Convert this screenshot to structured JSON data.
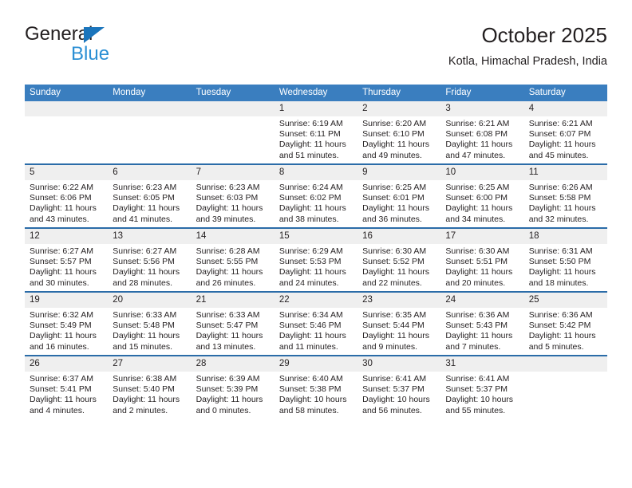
{
  "brand": {
    "name_top": "General",
    "name_bottom": "Blue",
    "accent_color": "#1b75bc",
    "accent_color_light": "#2b8fd4"
  },
  "header": {
    "title": "October 2025",
    "subtitle": "Kotla, Himachal Pradesh, India"
  },
  "theme": {
    "header_row_bg": "#3a7ebf",
    "week_separator": "#2b6ca8",
    "daynum_bg": "#efefef",
    "text": "#231f20"
  },
  "weekdays": [
    "Sunday",
    "Monday",
    "Tuesday",
    "Wednesday",
    "Thursday",
    "Friday",
    "Saturday"
  ],
  "labels": {
    "sunrise": "Sunrise:",
    "sunset": "Sunset:",
    "daylight": "Daylight:"
  },
  "weeks": [
    [
      {
        "day": "",
        "blank": true,
        "sunrise": "",
        "sunset": "",
        "daylight_line1": "",
        "daylight_line2": ""
      },
      {
        "day": "",
        "blank": true,
        "sunrise": "",
        "sunset": "",
        "daylight_line1": "",
        "daylight_line2": ""
      },
      {
        "day": "",
        "blank": true,
        "sunrise": "",
        "sunset": "",
        "daylight_line1": "",
        "daylight_line2": ""
      },
      {
        "day": "1",
        "blank": false,
        "sunrise": "Sunrise: 6:19 AM",
        "sunset": "Sunset: 6:11 PM",
        "daylight_line1": "Daylight: 11 hours",
        "daylight_line2": "and 51 minutes."
      },
      {
        "day": "2",
        "blank": false,
        "sunrise": "Sunrise: 6:20 AM",
        "sunset": "Sunset: 6:10 PM",
        "daylight_line1": "Daylight: 11 hours",
        "daylight_line2": "and 49 minutes."
      },
      {
        "day": "3",
        "blank": false,
        "sunrise": "Sunrise: 6:21 AM",
        "sunset": "Sunset: 6:08 PM",
        "daylight_line1": "Daylight: 11 hours",
        "daylight_line2": "and 47 minutes."
      },
      {
        "day": "4",
        "blank": false,
        "sunrise": "Sunrise: 6:21 AM",
        "sunset": "Sunset: 6:07 PM",
        "daylight_line1": "Daylight: 11 hours",
        "daylight_line2": "and 45 minutes."
      }
    ],
    [
      {
        "day": "5",
        "blank": false,
        "sunrise": "Sunrise: 6:22 AM",
        "sunset": "Sunset: 6:06 PM",
        "daylight_line1": "Daylight: 11 hours",
        "daylight_line2": "and 43 minutes."
      },
      {
        "day": "6",
        "blank": false,
        "sunrise": "Sunrise: 6:23 AM",
        "sunset": "Sunset: 6:05 PM",
        "daylight_line1": "Daylight: 11 hours",
        "daylight_line2": "and 41 minutes."
      },
      {
        "day": "7",
        "blank": false,
        "sunrise": "Sunrise: 6:23 AM",
        "sunset": "Sunset: 6:03 PM",
        "daylight_line1": "Daylight: 11 hours",
        "daylight_line2": "and 39 minutes."
      },
      {
        "day": "8",
        "blank": false,
        "sunrise": "Sunrise: 6:24 AM",
        "sunset": "Sunset: 6:02 PM",
        "daylight_line1": "Daylight: 11 hours",
        "daylight_line2": "and 38 minutes."
      },
      {
        "day": "9",
        "blank": false,
        "sunrise": "Sunrise: 6:25 AM",
        "sunset": "Sunset: 6:01 PM",
        "daylight_line1": "Daylight: 11 hours",
        "daylight_line2": "and 36 minutes."
      },
      {
        "day": "10",
        "blank": false,
        "sunrise": "Sunrise: 6:25 AM",
        "sunset": "Sunset: 6:00 PM",
        "daylight_line1": "Daylight: 11 hours",
        "daylight_line2": "and 34 minutes."
      },
      {
        "day": "11",
        "blank": false,
        "sunrise": "Sunrise: 6:26 AM",
        "sunset": "Sunset: 5:58 PM",
        "daylight_line1": "Daylight: 11 hours",
        "daylight_line2": "and 32 minutes."
      }
    ],
    [
      {
        "day": "12",
        "blank": false,
        "sunrise": "Sunrise: 6:27 AM",
        "sunset": "Sunset: 5:57 PM",
        "daylight_line1": "Daylight: 11 hours",
        "daylight_line2": "and 30 minutes."
      },
      {
        "day": "13",
        "blank": false,
        "sunrise": "Sunrise: 6:27 AM",
        "sunset": "Sunset: 5:56 PM",
        "daylight_line1": "Daylight: 11 hours",
        "daylight_line2": "and 28 minutes."
      },
      {
        "day": "14",
        "blank": false,
        "sunrise": "Sunrise: 6:28 AM",
        "sunset": "Sunset: 5:55 PM",
        "daylight_line1": "Daylight: 11 hours",
        "daylight_line2": "and 26 minutes."
      },
      {
        "day": "15",
        "blank": false,
        "sunrise": "Sunrise: 6:29 AM",
        "sunset": "Sunset: 5:53 PM",
        "daylight_line1": "Daylight: 11 hours",
        "daylight_line2": "and 24 minutes."
      },
      {
        "day": "16",
        "blank": false,
        "sunrise": "Sunrise: 6:30 AM",
        "sunset": "Sunset: 5:52 PM",
        "daylight_line1": "Daylight: 11 hours",
        "daylight_line2": "and 22 minutes."
      },
      {
        "day": "17",
        "blank": false,
        "sunrise": "Sunrise: 6:30 AM",
        "sunset": "Sunset: 5:51 PM",
        "daylight_line1": "Daylight: 11 hours",
        "daylight_line2": "and 20 minutes."
      },
      {
        "day": "18",
        "blank": false,
        "sunrise": "Sunrise: 6:31 AM",
        "sunset": "Sunset: 5:50 PM",
        "daylight_line1": "Daylight: 11 hours",
        "daylight_line2": "and 18 minutes."
      }
    ],
    [
      {
        "day": "19",
        "blank": false,
        "sunrise": "Sunrise: 6:32 AM",
        "sunset": "Sunset: 5:49 PM",
        "daylight_line1": "Daylight: 11 hours",
        "daylight_line2": "and 16 minutes."
      },
      {
        "day": "20",
        "blank": false,
        "sunrise": "Sunrise: 6:33 AM",
        "sunset": "Sunset: 5:48 PM",
        "daylight_line1": "Daylight: 11 hours",
        "daylight_line2": "and 15 minutes."
      },
      {
        "day": "21",
        "blank": false,
        "sunrise": "Sunrise: 6:33 AM",
        "sunset": "Sunset: 5:47 PM",
        "daylight_line1": "Daylight: 11 hours",
        "daylight_line2": "and 13 minutes."
      },
      {
        "day": "22",
        "blank": false,
        "sunrise": "Sunrise: 6:34 AM",
        "sunset": "Sunset: 5:46 PM",
        "daylight_line1": "Daylight: 11 hours",
        "daylight_line2": "and 11 minutes."
      },
      {
        "day": "23",
        "blank": false,
        "sunrise": "Sunrise: 6:35 AM",
        "sunset": "Sunset: 5:44 PM",
        "daylight_line1": "Daylight: 11 hours",
        "daylight_line2": "and 9 minutes."
      },
      {
        "day": "24",
        "blank": false,
        "sunrise": "Sunrise: 6:36 AM",
        "sunset": "Sunset: 5:43 PM",
        "daylight_line1": "Daylight: 11 hours",
        "daylight_line2": "and 7 minutes."
      },
      {
        "day": "25",
        "blank": false,
        "sunrise": "Sunrise: 6:36 AM",
        "sunset": "Sunset: 5:42 PM",
        "daylight_line1": "Daylight: 11 hours",
        "daylight_line2": "and 5 minutes."
      }
    ],
    [
      {
        "day": "26",
        "blank": false,
        "sunrise": "Sunrise: 6:37 AM",
        "sunset": "Sunset: 5:41 PM",
        "daylight_line1": "Daylight: 11 hours",
        "daylight_line2": "and 4 minutes."
      },
      {
        "day": "27",
        "blank": false,
        "sunrise": "Sunrise: 6:38 AM",
        "sunset": "Sunset: 5:40 PM",
        "daylight_line1": "Daylight: 11 hours",
        "daylight_line2": "and 2 minutes."
      },
      {
        "day": "28",
        "blank": false,
        "sunrise": "Sunrise: 6:39 AM",
        "sunset": "Sunset: 5:39 PM",
        "daylight_line1": "Daylight: 11 hours",
        "daylight_line2": "and 0 minutes."
      },
      {
        "day": "29",
        "blank": false,
        "sunrise": "Sunrise: 6:40 AM",
        "sunset": "Sunset: 5:38 PM",
        "daylight_line1": "Daylight: 10 hours",
        "daylight_line2": "and 58 minutes."
      },
      {
        "day": "30",
        "blank": false,
        "sunrise": "Sunrise: 6:41 AM",
        "sunset": "Sunset: 5:37 PM",
        "daylight_line1": "Daylight: 10 hours",
        "daylight_line2": "and 56 minutes."
      },
      {
        "day": "31",
        "blank": false,
        "sunrise": "Sunrise: 6:41 AM",
        "sunset": "Sunset: 5:37 PM",
        "daylight_line1": "Daylight: 10 hours",
        "daylight_line2": "and 55 minutes."
      },
      {
        "day": "",
        "blank": true,
        "sunrise": "",
        "sunset": "",
        "daylight_line1": "",
        "daylight_line2": ""
      }
    ]
  ]
}
